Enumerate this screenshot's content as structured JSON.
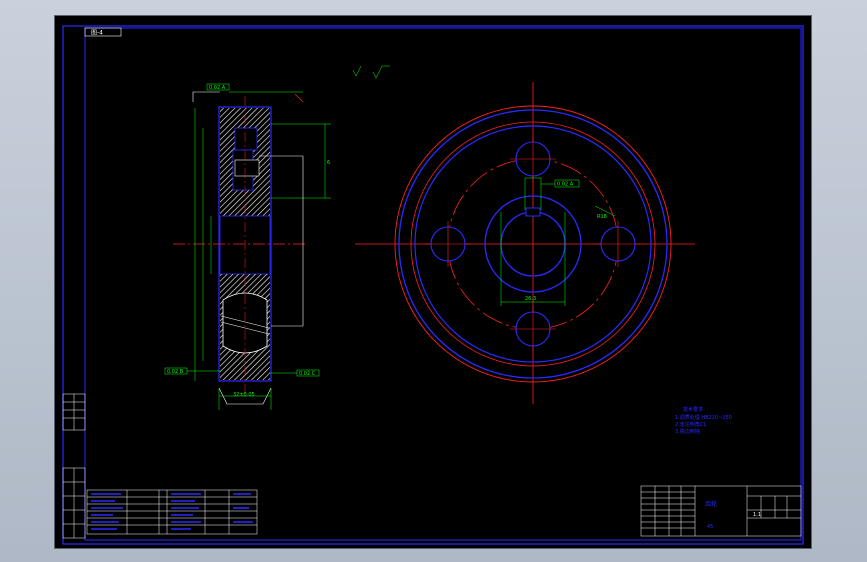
{
  "drawing": {
    "sheet_code": "图-4",
    "title_block": {
      "drawing_name": "齿轮",
      "material": "45",
      "scale": "1:1"
    },
    "section_labels": {
      "datum_a": "0.02 A",
      "datum_b": "0.02 B",
      "datum_c": "0.02 C",
      "datum_d": "0.02 A"
    },
    "dimensions": {
      "width": "32±0.05",
      "depth": "6",
      "radius": "R18",
      "keyway": "26.3"
    },
    "notes": {
      "heading": "技术要求",
      "line1": "1.调质处理 HB220~250",
      "line2": "2.未注倒角C1",
      "line3": "3.锐边倒钝"
    },
    "colors": {
      "sheet": "#000000",
      "frame": "#1a1aff",
      "centerline": "#ff2020",
      "dimension": "#00ff00",
      "outline": "#ffffff"
    }
  }
}
